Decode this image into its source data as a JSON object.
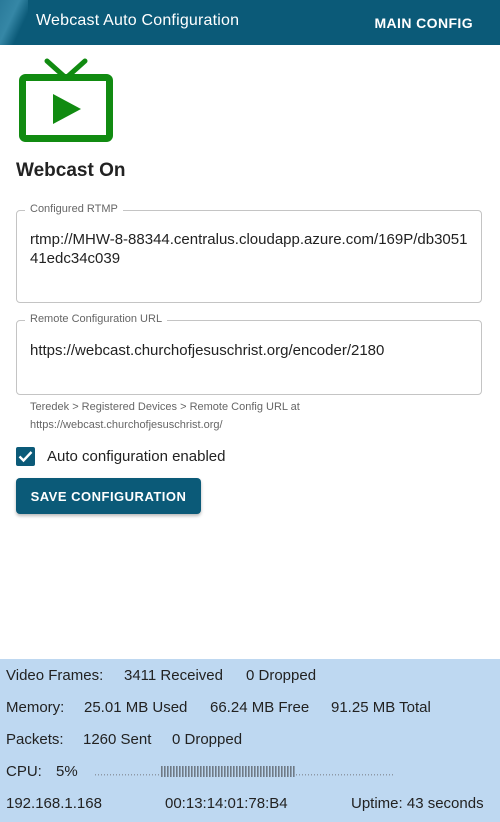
{
  "appbar": {
    "title": "Webcast Auto Configuration",
    "main_config_label": "MAIN CONFIG"
  },
  "icons": {
    "tv": "live-tv-icon",
    "check": "check-icon"
  },
  "colors": {
    "primary": "#0b5a78",
    "tv_green": "#118b11",
    "stats_bg": "#bed8f1"
  },
  "status": {
    "title": "Webcast On"
  },
  "rtmp_field": {
    "label": "Configured RTMP",
    "value": "rtmp://MHW-8-88344.centralus.cloudapp.azure.com/169P/db305141edc34c039"
  },
  "url_field": {
    "label": "Remote Configuration URL",
    "value": "https://webcast.churchofjesuschrist.org/encoder/2180",
    "helper": "Teredek > Registered Devices > Remote Config URL at https://webcast.churchofjesuschrist.org/"
  },
  "auto_config": {
    "label": "Auto configuration enabled",
    "checked": true
  },
  "save_button": {
    "label": "SAVE CONFIGURATION"
  },
  "stats": {
    "frames_label": "Video Frames:",
    "frames_received": "3411 Received",
    "frames_dropped": "0 Dropped",
    "memory_label": "Memory:",
    "memory_used": "25.01 MB Used",
    "memory_free": "66.24 MB Free",
    "memory_total": "91.25 MB Total",
    "packets_label": "Packets:",
    "packets_sent": "1260 Sent",
    "packets_dropped": "0 Dropped",
    "cpu_label": "CPU:",
    "cpu_value": "5%",
    "ip": "192.168.1.168",
    "mac": "00:13:14:01:78:B4",
    "uptime": "Uptime: 43 seconds"
  }
}
